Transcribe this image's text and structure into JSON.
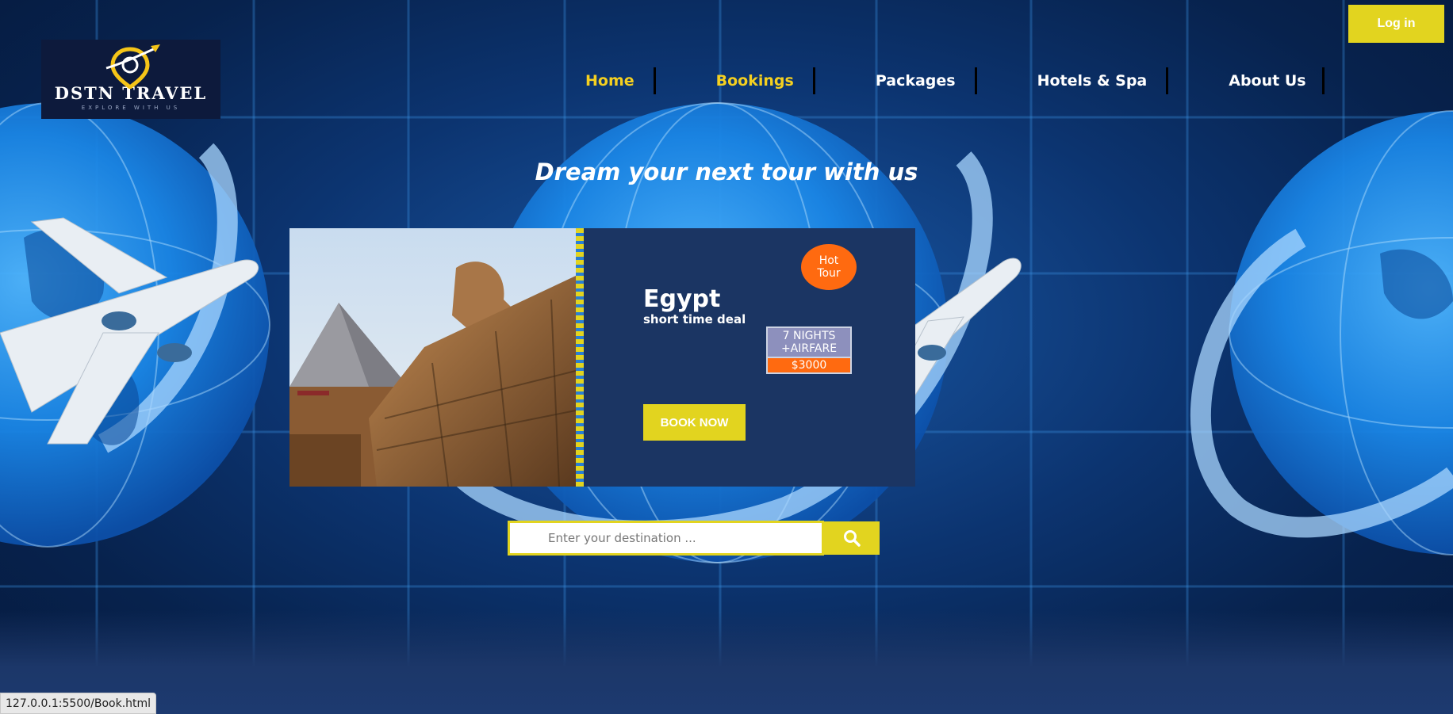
{
  "header": {
    "login_label": "Log in",
    "logo": {
      "title": "DSTN TRAVEL",
      "tagline": "EXPLORE WITH US"
    }
  },
  "nav": {
    "items": [
      {
        "label": "Home",
        "active": true
      },
      {
        "label": "Bookings",
        "active": true
      },
      {
        "label": "Packages",
        "active": false
      },
      {
        "label": "Hotels & Spa",
        "active": false
      },
      {
        "label": "About Us",
        "active": false
      }
    ]
  },
  "hero": {
    "headline": "Dream your next tour with us"
  },
  "tour_card": {
    "destination": "Egypt",
    "subtitle": "short time deal",
    "badge_line1": "Hot",
    "badge_line2": "Tour",
    "offer_line1": "7 NIGHTS",
    "offer_line2": "+AIRFARE",
    "price": "$3000",
    "book_label": "BOOK NOW"
  },
  "search": {
    "placeholder": "Enter your destination ..."
  },
  "status_bar": {
    "url": "127.0.0.1:5500/Book.html"
  },
  "colors": {
    "accent_yellow": "#e2d41f",
    "accent_orange": "#ff6a10",
    "card_navy": "#1b3563",
    "active_nav": "#f5d020"
  }
}
